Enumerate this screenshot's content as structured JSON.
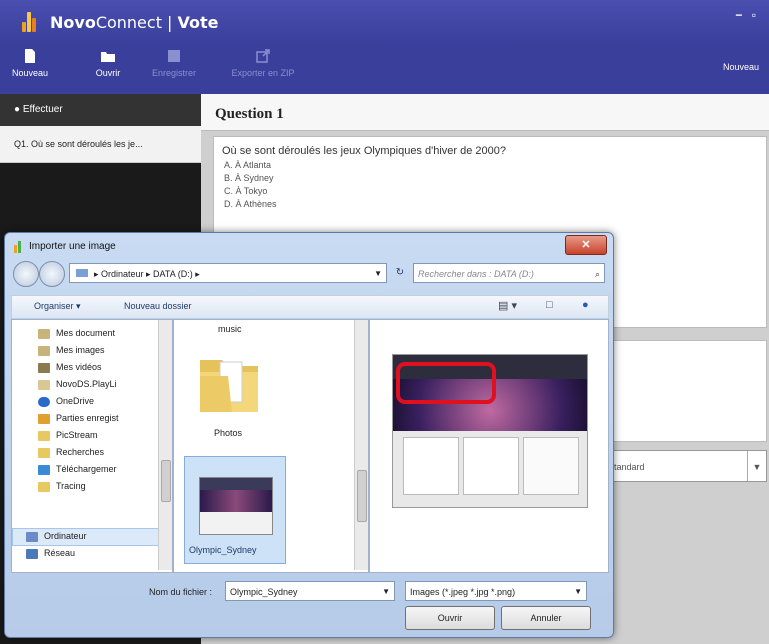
{
  "app": {
    "brand_bold": "Novo",
    "brand_rest": "Connect",
    "separator": " | ",
    "module": "Vote",
    "window_controls": "− ▫"
  },
  "toolbar": {
    "buttons": [
      {
        "label": "Nouveau",
        "enabled": true
      },
      {
        "label": "Ouvrir",
        "enabled": true
      },
      {
        "label": "Enregistrer",
        "enabled": false
      },
      {
        "label": "Exporter en ZIP",
        "enabled": false
      }
    ],
    "right_label": "Nouveau"
  },
  "sidebar": {
    "header": "Effectuer",
    "items": [
      "Q1. Où se sont déroulés les je..."
    ]
  },
  "question": {
    "title": "Question 1",
    "text": "Où se sont déroulés les jeux Olympiques d'hiver de 2000?",
    "options": [
      "A. À Atlanta",
      "B. À Sydney",
      "C. À Tokyo",
      "D. À Athènes"
    ]
  },
  "answer_combo": {
    "value": "Standard"
  },
  "dialog": {
    "title": "Importer une image",
    "close": "✕",
    "address": "▸ Ordinateur ▸ DATA (D:) ▸",
    "search_placeholder": "Rechercher dans : DATA (D:)",
    "commands": {
      "organize": "Organiser ▾",
      "new_folder": "Nouveau dossier"
    },
    "tree": [
      "Mes document",
      "Mes images",
      "Mes vidéos",
      "NovoDS.PlayLi",
      "OneDrive",
      "Parties enregist",
      "PicStream",
      "Recherches",
      "Téléchargemer",
      "Tracing",
      "Ordinateur",
      "Réseau"
    ],
    "tree_selected": "Ordinateur",
    "files": {
      "music_label": "music",
      "folder_label": "Photos",
      "image_label": "Olympic_Sydney"
    },
    "filename_label": "Nom du fichier :",
    "filename_value": "Olympic_Sydney",
    "filter_value": "Images (*.jpeg *.jpg *.png)",
    "open_button": "Ouvrir",
    "cancel_button": "Annuler"
  },
  "colors": {
    "app_header": "#3b3f9c",
    "highlight": "#e0101e",
    "dialog_frame": "#b5cbe8"
  }
}
